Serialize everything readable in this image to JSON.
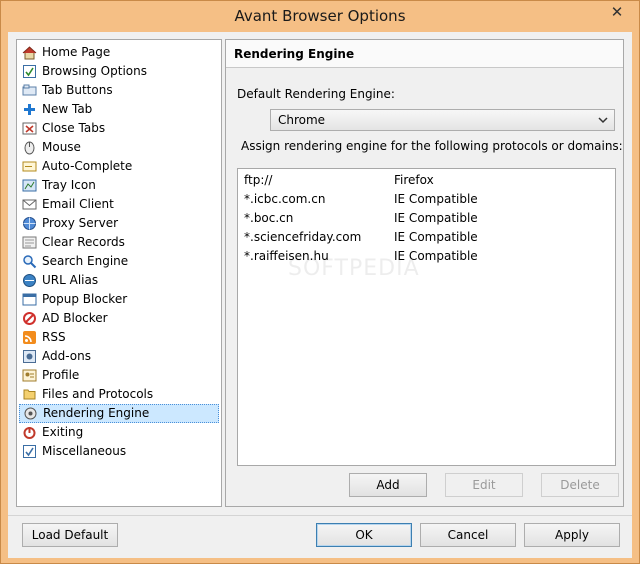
{
  "window": {
    "title": "Avant Browser Options",
    "close_symbol": "✕"
  },
  "tree": {
    "items": [
      {
        "label": "Home Page",
        "icon": "home-icon"
      },
      {
        "label": "Browsing Options",
        "icon": "browsing-icon"
      },
      {
        "label": "Tab Buttons",
        "icon": "tab-buttons-icon"
      },
      {
        "label": "New Tab",
        "icon": "plus-icon"
      },
      {
        "label": "Close Tabs",
        "icon": "close-tabs-icon"
      },
      {
        "label": "Mouse",
        "icon": "mouse-icon"
      },
      {
        "label": "Auto-Complete",
        "icon": "autocomplete-icon"
      },
      {
        "label": "Tray Icon",
        "icon": "tray-icon"
      },
      {
        "label": "Email Client",
        "icon": "email-icon"
      },
      {
        "label": "Proxy Server",
        "icon": "proxy-icon"
      },
      {
        "label": "Clear Records",
        "icon": "clear-records-icon"
      },
      {
        "label": "Search Engine",
        "icon": "search-icon"
      },
      {
        "label": "URL Alias",
        "icon": "url-alias-icon"
      },
      {
        "label": "Popup Blocker",
        "icon": "popup-blocker-icon"
      },
      {
        "label": "AD Blocker",
        "icon": "ad-blocker-icon"
      },
      {
        "label": "RSS",
        "icon": "rss-icon"
      },
      {
        "label": "Add-ons",
        "icon": "addons-icon"
      },
      {
        "label": "Profile",
        "icon": "profile-icon"
      },
      {
        "label": "Files and Protocols",
        "icon": "files-icon"
      },
      {
        "label": "Rendering Engine",
        "icon": "rendering-icon",
        "selected": true
      },
      {
        "label": "Exiting",
        "icon": "power-icon"
      },
      {
        "label": "Miscellaneous",
        "icon": "misc-icon"
      }
    ]
  },
  "panel": {
    "header": "Rendering Engine",
    "default_label": "Default Rendering Engine:",
    "default_value": "Chrome",
    "assign_label": "Assign rendering engine for the following protocols or domains:",
    "rows": [
      {
        "domain": "ftp://",
        "engine": "Firefox"
      },
      {
        "domain": "*.icbc.com.cn",
        "engine": "IE Compatible"
      },
      {
        "domain": "*.boc.cn",
        "engine": "IE Compatible"
      },
      {
        "domain": "*.sciencefriday.com",
        "engine": "IE Compatible"
      },
      {
        "domain": "*.raiffeisen.hu",
        "engine": "IE Compatible"
      }
    ],
    "add_label": "Add",
    "edit_label": "Edit",
    "delete_label": "Delete"
  },
  "footer": {
    "load_default_label": "Load Default",
    "ok_label": "OK",
    "cancel_label": "Cancel",
    "apply_label": "Apply"
  },
  "watermark": "SOFTPEDIA",
  "colors": {
    "title_bar": "#f5bf85",
    "selection": "#cce8ff"
  }
}
